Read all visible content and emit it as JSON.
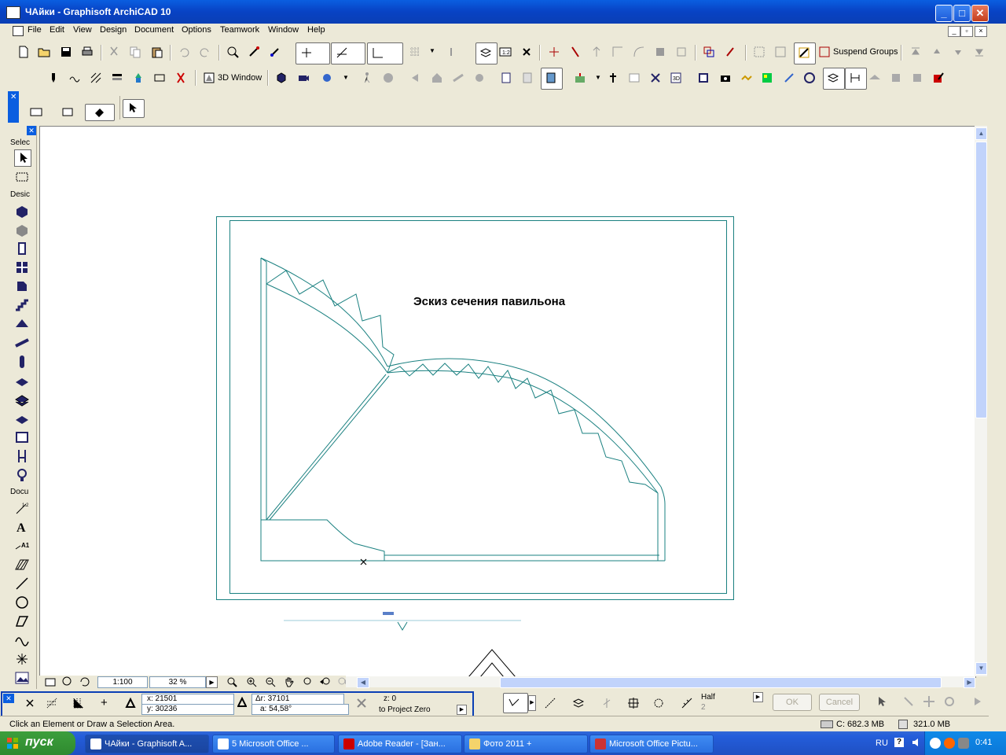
{
  "window": {
    "title": "ЧАйки - Graphisoft ArchiCAD 10"
  },
  "menu": [
    "File",
    "Edit",
    "View",
    "Design",
    "Document",
    "Options",
    "Teamwork",
    "Window",
    "Help"
  ],
  "toolbar": {
    "suspend_groups_label": "Suspend Groups",
    "window_3d_label": "3D Window"
  },
  "toolbox": {
    "select_label": "Selec",
    "design_label": "Desic",
    "document_label": "Docu"
  },
  "drawing": {
    "title": "Эскиз  сечения павильона"
  },
  "navigation": {
    "scale": "1:100",
    "zoom": "32 %"
  },
  "coordinates": {
    "x": "x: 21501",
    "y": "y: 30236",
    "dr": "Δr: 37101",
    "a": "a: 54,58°",
    "z": "z: 0",
    "reference": "to Project Zero"
  },
  "modes": {
    "half_label": "Half",
    "half_value": "2",
    "ok_label": "OK",
    "cancel_label": "Cancel"
  },
  "status": {
    "message": "Click an Element or Draw a Selection Area.",
    "disk": "C: 682.3 MB",
    "memory": "321.0 MB"
  },
  "taskbar": {
    "start_label": "пуск",
    "tasks": [
      "ЧАйки - Graphisoft A...",
      "5 Microsoft Office ...",
      "Adobe Reader - [Зан...",
      "Фото 2011 +",
      "Microsoft Office Pictu..."
    ],
    "language": "RU",
    "clock": "0:41"
  },
  "colors": {
    "drawing_line": "#1a8080",
    "title_bar": "#0a5ee0",
    "taskbar": "#245edb",
    "start": "#3c9f3c"
  }
}
